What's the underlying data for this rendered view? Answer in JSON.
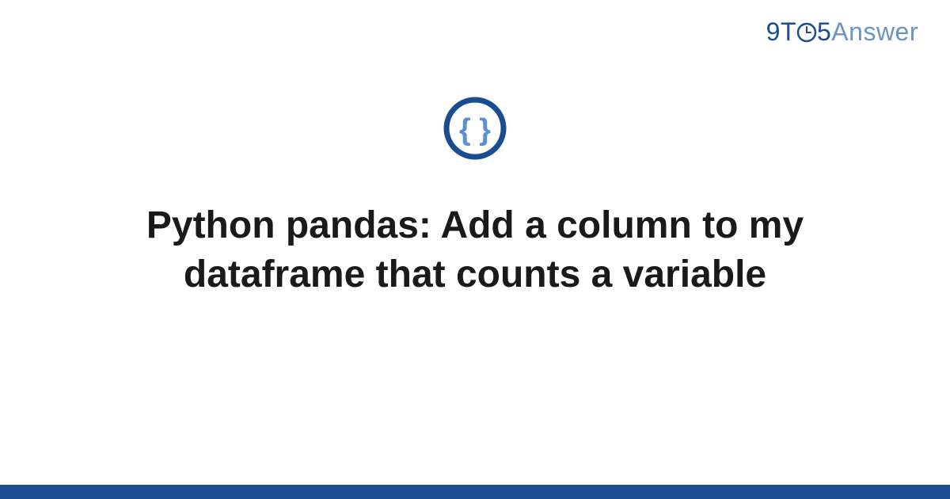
{
  "brand": {
    "part1": "9",
    "part2": "T",
    "part3": "5",
    "part4": "Answer"
  },
  "title": "Python pandas: Add a column to my dataframe that counts a variable",
  "colors": {
    "primary": "#1a4d8f",
    "secondary": "#6b93c4",
    "iconInner": "#5a8fd4"
  }
}
